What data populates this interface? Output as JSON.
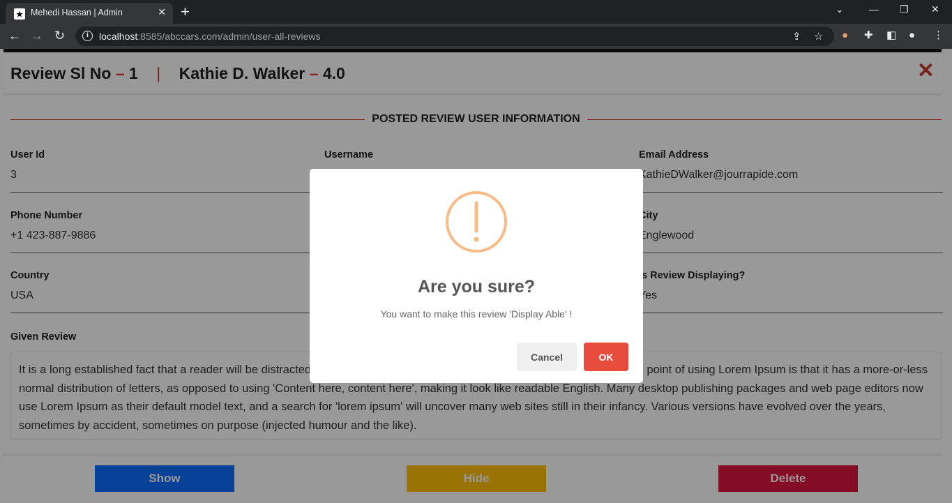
{
  "browser": {
    "tab_title": "Mehedi Hassan | Admin",
    "url_host": "localhost",
    "url_rest": ":8585/abccars.com/admin/user-all-reviews"
  },
  "modal": {
    "sl_label": "Review Sl No",
    "sl_sep": "–",
    "sl_no": "1",
    "divider": "|",
    "user_name": "Kathie D. Walker",
    "rating_sep": "–",
    "rating": "4.0",
    "close_glyph": "✕",
    "section_title": "POSTED REVIEW USER INFORMATION",
    "fields": [
      {
        "label": "User Id",
        "value": "3"
      },
      {
        "label": "Username",
        "value": ""
      },
      {
        "label": "Email Address",
        "value": "KathieDWalker@jourrapide.com"
      },
      {
        "label": "Phone Number",
        "value": "+1 423-887-9886"
      },
      {
        "label": "City",
        "value": "Englewood"
      },
      {
        "label": "Country",
        "value": "USA"
      },
      {
        "label": "Is Review Displaying?",
        "value": "Yes"
      }
    ],
    "review_label": "Given Review",
    "review_text": "It is a long established fact that a reader will be distracted by the readable content of a page when looking at its layout. The point of using Lorem Ipsum is that it has a more-or-less normal distribution of letters, as opposed to using 'Content here, content here', making it look like readable English. Many desktop publishing packages and web page editors now use Lorem Ipsum as their default model text, and a search for 'lorem ipsum' will uncover many web sites still in their infancy. Various versions have evolved over the years, sometimes by accident, sometimes on purpose (injected humour and the like).",
    "buttons": {
      "show": "Show",
      "hide": "Hide",
      "delete": "Delete"
    }
  },
  "dialog": {
    "title": "Are you sure?",
    "text": "You want to make this review 'Display Able' !",
    "cancel": "Cancel",
    "ok": "OK"
  },
  "colors": {
    "show": "#0d6efd",
    "hide": "#ffc107",
    "delete": "#dc143c",
    "ok": "#e74c3c",
    "warning": "#f8bb86",
    "accent_red": "#e3342f"
  }
}
